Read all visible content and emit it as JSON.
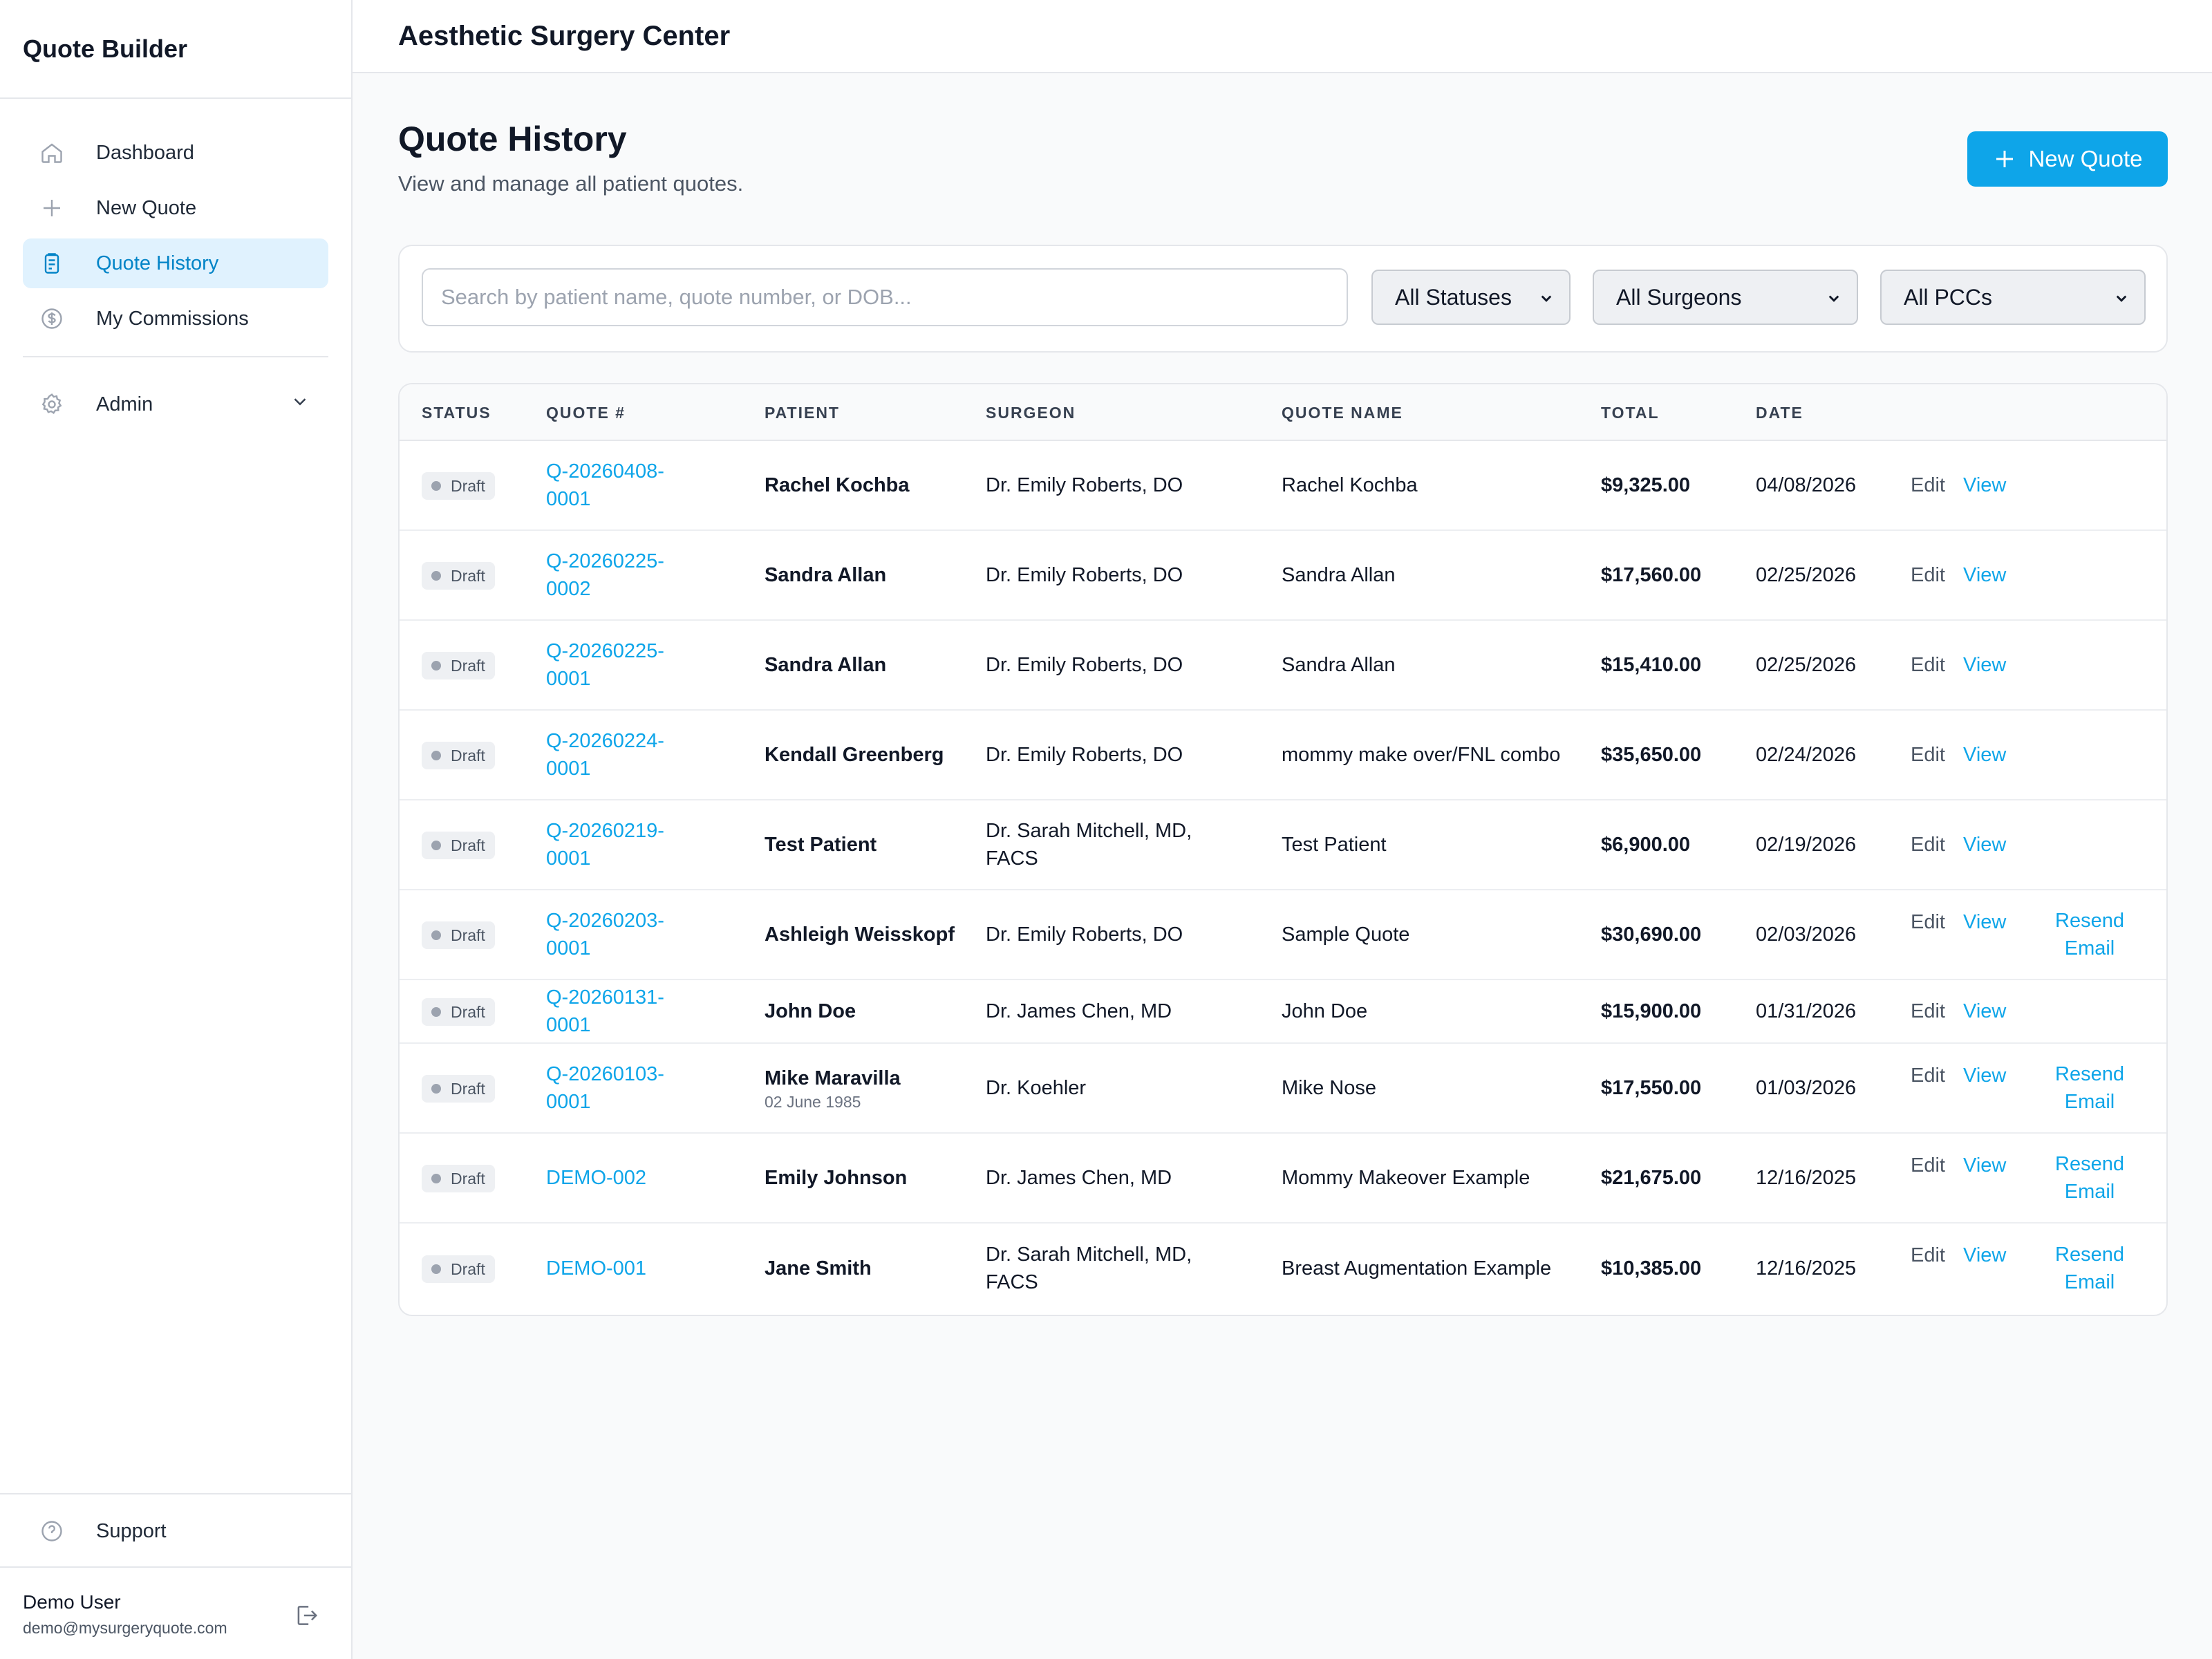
{
  "app": {
    "title": "Quote Builder"
  },
  "sidebar": {
    "items": [
      {
        "label": "Dashboard",
        "icon": "home-icon"
      },
      {
        "label": "New Quote",
        "icon": "plus-icon"
      },
      {
        "label": "Quote History",
        "icon": "clipboard-icon",
        "active": true
      },
      {
        "label": "My Commissions",
        "icon": "dollar-icon"
      }
    ],
    "admin": {
      "label": "Admin",
      "icon": "gear-icon"
    },
    "support": {
      "label": "Support",
      "icon": "help-icon"
    },
    "user": {
      "name": "Demo User",
      "email": "demo@mysurgeryquote.com"
    }
  },
  "topbar": {
    "org_name": "Aesthetic Surgery Center"
  },
  "page": {
    "title": "Quote History",
    "subtitle": "View and manage all patient quotes.",
    "new_quote_label": "New Quote"
  },
  "filters": {
    "search_placeholder": "Search by patient name, quote number, or DOB...",
    "status": "All Statuses",
    "surgeon": "All Surgeons",
    "pcc": "All PCCs"
  },
  "table": {
    "headers": {
      "status": "Status",
      "quote": "Quote #",
      "patient": "Patient",
      "surgeon": "Surgeon",
      "quote_name": "Quote Name",
      "total": "Total",
      "date": "Date"
    },
    "actions": {
      "edit": "Edit",
      "view": "View",
      "resend": "Resend Email"
    },
    "rows": [
      {
        "status": "Draft",
        "quote": "Q-20260408-0001",
        "patient": "Rachel Kochba",
        "dob": "",
        "surgeon": "Dr. Emily Roberts, DO",
        "quote_name": "Rachel Kochba",
        "total": "$9,325.00",
        "date": "04/08/2026",
        "resend": false
      },
      {
        "status": "Draft",
        "quote": "Q-20260225-0002",
        "patient": "Sandra Allan",
        "dob": "",
        "surgeon": "Dr. Emily Roberts, DO",
        "quote_name": "Sandra Allan",
        "total": "$17,560.00",
        "date": "02/25/2026",
        "resend": false
      },
      {
        "status": "Draft",
        "quote": "Q-20260225-0001",
        "patient": "Sandra Allan",
        "dob": "",
        "surgeon": "Dr. Emily Roberts, DO",
        "quote_name": "Sandra Allan",
        "total": "$15,410.00",
        "date": "02/25/2026",
        "resend": false
      },
      {
        "status": "Draft",
        "quote": "Q-20260224-0001",
        "patient": "Kendall Greenberg",
        "dob": "",
        "surgeon": "Dr. Emily Roberts, DO",
        "quote_name": "mommy make over/FNL combo",
        "total": "$35,650.00",
        "date": "02/24/2026",
        "resend": false
      },
      {
        "status": "Draft",
        "quote": "Q-20260219-0001",
        "patient": "Test Patient",
        "dob": "",
        "surgeon": "Dr. Sarah Mitchell, MD, FACS",
        "quote_name": "Test Patient",
        "total": "$6,900.00",
        "date": "02/19/2026",
        "resend": false
      },
      {
        "status": "Draft",
        "quote": "Q-20260203-0001",
        "patient": "Ashleigh Weisskopf",
        "dob": "",
        "surgeon": "Dr. Emily Roberts, DO",
        "quote_name": "Sample Quote",
        "total": "$30,690.00",
        "date": "02/03/2026",
        "resend": true
      },
      {
        "status": "Draft",
        "quote": "Q-20260131-0001",
        "patient": "John Doe",
        "dob": "",
        "surgeon": "Dr. James Chen, MD",
        "quote_name": "John Doe",
        "total": "$15,900.00",
        "date": "01/31/2026",
        "resend": false
      },
      {
        "status": "Draft",
        "quote": "Q-20260103-0001",
        "patient": "Mike Maravilla",
        "dob": "02 June 1985",
        "surgeon": "Dr. Koehler",
        "quote_name": "Mike Nose",
        "total": "$17,550.00",
        "date": "01/03/2026",
        "resend": true
      },
      {
        "status": "Draft",
        "quote": "DEMO-002",
        "patient": "Emily Johnson",
        "dob": "",
        "surgeon": "Dr. James Chen, MD",
        "quote_name": "Mommy Makeover Example",
        "total": "$21,675.00",
        "date": "12/16/2025",
        "resend": true
      },
      {
        "status": "Draft",
        "quote": "DEMO-001",
        "patient": "Jane Smith",
        "dob": "",
        "surgeon": "Dr. Sarah Mitchell, MD, FACS",
        "quote_name": "Breast Augmentation Example",
        "total": "$10,385.00",
        "date": "12/16/2025",
        "resend": true
      }
    ]
  },
  "colors": {
    "accent": "#0ea5e9",
    "active_bg": "#e0f2fe",
    "active_text": "#0284c7"
  }
}
